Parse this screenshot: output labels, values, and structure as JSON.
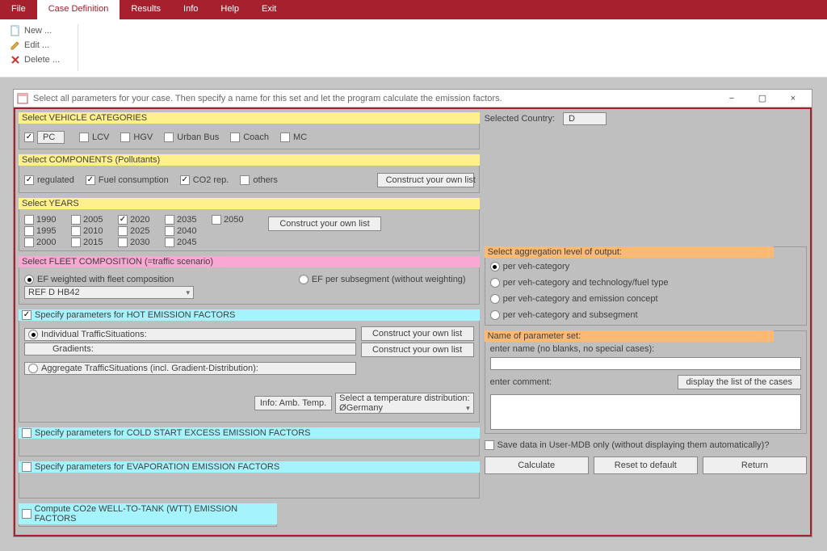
{
  "menu": {
    "items": [
      "File",
      "Case Definition",
      "Results",
      "Info",
      "Help",
      "Exit"
    ],
    "active_index": 1
  },
  "ribbon": {
    "new": "New ...",
    "edit": "Edit ...",
    "delete": "Delete ..."
  },
  "window": {
    "title": "Select all parameters for your case. Then specify a name for this set and let the program calculate the emission factors.",
    "minimize": "−",
    "maximize": "▢",
    "close": "×"
  },
  "vehicle_categories": {
    "legend": "Select VEHICLE CATEGORIES",
    "items": [
      {
        "label": "PC",
        "checked": true,
        "boxed": true
      },
      {
        "label": "LCV",
        "checked": false
      },
      {
        "label": "HGV",
        "checked": false
      },
      {
        "label": "Urban Bus",
        "checked": false
      },
      {
        "label": "Coach",
        "checked": false
      },
      {
        "label": "MC",
        "checked": false
      }
    ]
  },
  "components": {
    "legend": "Select COMPONENTS (Pollutants)",
    "items": [
      {
        "label": "regulated",
        "checked": true
      },
      {
        "label": "Fuel consumption",
        "checked": true
      },
      {
        "label": "CO2 rep.",
        "checked": true
      },
      {
        "label": "others",
        "checked": false
      }
    ],
    "button": "Construct your own list"
  },
  "years": {
    "legend": "Select YEARS",
    "items": [
      {
        "label": "1990",
        "checked": false
      },
      {
        "label": "2005",
        "checked": false
      },
      {
        "label": "2020",
        "checked": true
      },
      {
        "label": "2035",
        "checked": false
      },
      {
        "label": "2050",
        "checked": false
      },
      {
        "label": "1995",
        "checked": false
      },
      {
        "label": "2010",
        "checked": false
      },
      {
        "label": "2025",
        "checked": false
      },
      {
        "label": "2040",
        "checked": false
      },
      {
        "label": "",
        "checked": null
      },
      {
        "label": "2000",
        "checked": false
      },
      {
        "label": "2015",
        "checked": false
      },
      {
        "label": "2030",
        "checked": false
      },
      {
        "label": "2045",
        "checked": false
      },
      {
        "label": "",
        "checked": null
      }
    ],
    "button": "Construct your own list"
  },
  "fleet": {
    "legend": "Select FLEET COMPOSITION (=traffic scenario)",
    "opt1": "EF weighted with fleet composition",
    "opt2": "EF per subsegment (without weighting)",
    "selected": 1,
    "dropdown": "REF D HB42"
  },
  "hot": {
    "check_label": "Specify parameters for HOT EMISSION FACTORS",
    "opt1": "Individual TrafficSituations:",
    "sub1": "Gradients:",
    "opt2": "Aggregate TrafficSituations (incl. Gradient-Distribution):",
    "btn1": "Construct your own list",
    "btn2": "Construct your own list",
    "info_btn": "Info: Amb. Temp.",
    "temp_label": "Select a temperature distribution:",
    "temp_value": "ØGermany"
  },
  "cold": {
    "label": "Specify parameters for COLD START EXCESS EMISSION FACTORS"
  },
  "evap": {
    "label": "Specify parameters for EVAPORATION EMISSION FACTORS"
  },
  "wtt": {
    "label": "Compute CO2e WELL-TO-TANK (WTT) EMISSION FACTORS"
  },
  "right": {
    "country_label": "Selected Country:",
    "country_value": "D",
    "agg_legend": "Select aggregation level of output:",
    "agg_opts": [
      "per veh-category",
      "per veh-category and technology/fuel type",
      "per veh-category and emission concept",
      "per veh-category and subsegment"
    ],
    "agg_selected": 0,
    "name_legend": "Name of parameter set:",
    "name_hint": "enter name (no blanks, no special cases):",
    "display_btn": "display the list of the cases",
    "comment_label": "enter comment:",
    "save_label": "Save data in User-MDB only (without displaying them automatically)?",
    "btn_calc": "Calculate",
    "btn_reset": "Reset to default",
    "btn_return": "Return"
  }
}
